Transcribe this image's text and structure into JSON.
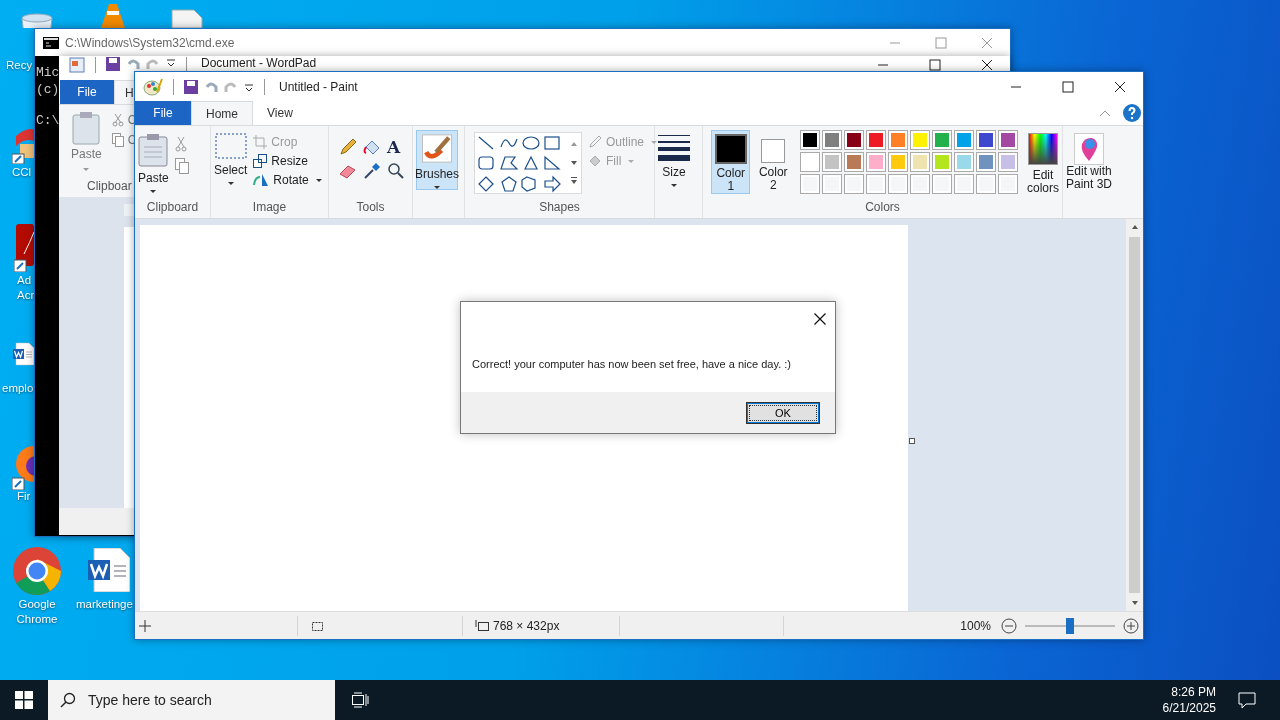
{
  "desktop": {
    "icons": [
      {
        "kind": "recycle",
        "lines": [
          "Recy"
        ]
      },
      {
        "kind": "cone"
      },
      {
        "kind": "file"
      },
      {
        "kind": "cleaner",
        "lines": [
          "CCl"
        ]
      },
      {
        "kind": "acrobat",
        "lines": [
          "Ad",
          "Acr"
        ]
      },
      {
        "kind": "word",
        "lines": [
          "emplo"
        ]
      },
      {
        "kind": "firefox",
        "lines": [
          "Fir"
        ]
      },
      {
        "kind": "chrome",
        "lines": [
          "Google",
          "Chrome"
        ]
      },
      {
        "kind": "word",
        "lines": [
          "marketinge"
        ]
      }
    ]
  },
  "cmd": {
    "title": "C:\\Windows\\System32\\cmd.exe",
    "lines": [
      "Mic",
      "(c)",
      "C:\\"
    ]
  },
  "wordpad": {
    "title": "Document - WordPad",
    "tabs": [
      {
        "label": "File",
        "selected": false
      },
      {
        "label": "H",
        "selected": true
      }
    ],
    "paste": "Paste",
    "tool_letters": [
      "C",
      "C"
    ],
    "group": "Clipboar"
  },
  "paint": {
    "title": "Untitled - Paint",
    "tabs": [
      {
        "label": "File",
        "kind": "file",
        "selected": false
      },
      {
        "label": "Home",
        "kind": "tab",
        "selected": true
      },
      {
        "label": "View",
        "kind": "tab",
        "selected": false
      }
    ],
    "clipboard": {
      "label": "Clipboard",
      "paste": "Paste"
    },
    "image": {
      "label": "Image",
      "select": "Select",
      "crop": "Crop",
      "resize": "Resize",
      "rotate": "Rotate"
    },
    "tools": {
      "label": "Tools",
      "text_glyph": "A"
    },
    "brushes": {
      "label": "Brushes",
      "selected": true
    },
    "shapes": {
      "label": "Shapes",
      "outline": "Outline",
      "fill": "Fill"
    },
    "size": {
      "label": "Size"
    },
    "colors": {
      "label": "Colors",
      "color1": {
        "lines": [
          "Color",
          "1"
        ],
        "selected": true,
        "color": "#000000"
      },
      "color2": {
        "lines": [
          "Color",
          "2"
        ],
        "selected": false,
        "color": "#ffffff"
      },
      "palette": [
        {
          "color": "#000000"
        },
        {
          "color": "#7f7f7f"
        },
        {
          "color": "#880015"
        },
        {
          "color": "#ed1c24"
        },
        {
          "color": "#ff7f27"
        },
        {
          "color": "#fff200"
        },
        {
          "color": "#22b14c"
        },
        {
          "color": "#00a2e8"
        },
        {
          "color": "#3f48cc"
        },
        {
          "color": "#a349a4"
        },
        {
          "color": "#ffffff"
        },
        {
          "color": "#c3c3c3"
        },
        {
          "color": "#b97a57"
        },
        {
          "color": "#ffaec9"
        },
        {
          "color": "#ffc90e"
        },
        {
          "color": "#efe4b0"
        },
        {
          "color": "#b5e61d"
        },
        {
          "color": "#99d9ea"
        },
        {
          "color": "#7092be"
        },
        {
          "color": "#c8bfe7"
        }
      ],
      "edit": [
        "Edit",
        "colors"
      ]
    },
    "paint3d": [
      "Edit with",
      "Paint 3D"
    ],
    "status": {
      "dimensions": "768 × 432px",
      "zoom": "100%",
      "level": 0.5
    }
  },
  "dialog": {
    "message": "Correct! your computer has now been set free, have a nice day. :)",
    "ok": "OK"
  },
  "taskbar": {
    "search_placeholder": "Type here to search",
    "time": "8:26 PM",
    "date": "6/21/2025"
  }
}
